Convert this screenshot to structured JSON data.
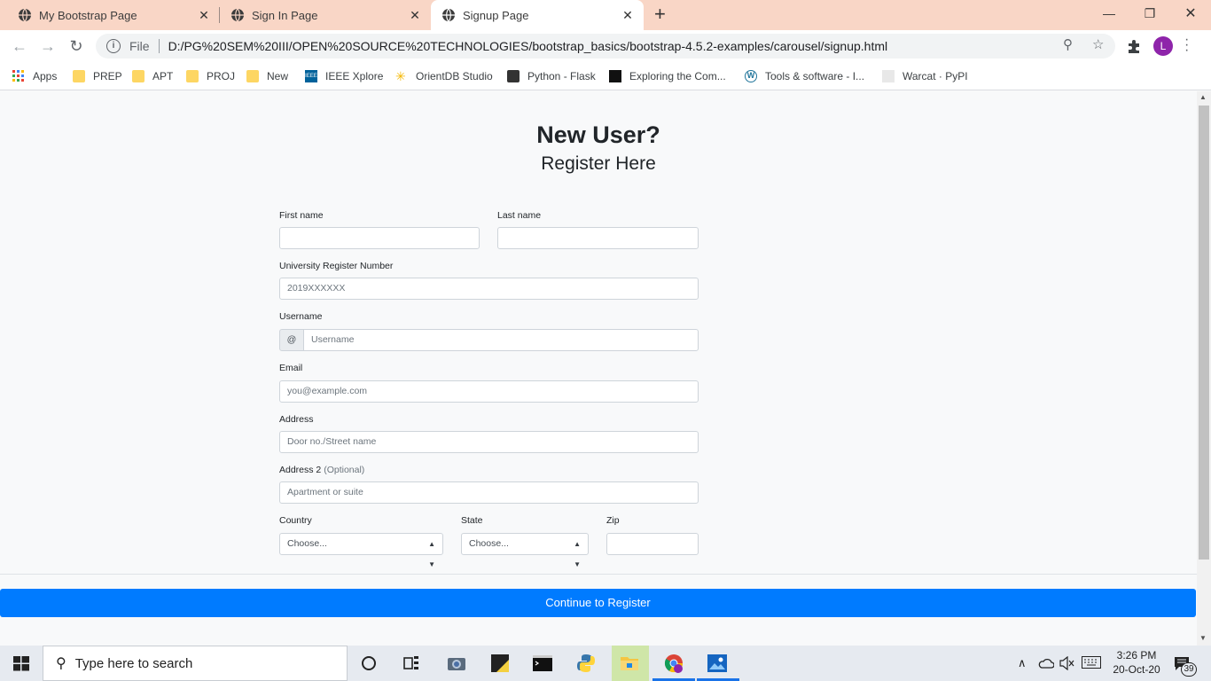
{
  "browser": {
    "tabs": [
      {
        "title": "My Bootstrap Page"
      },
      {
        "title": "Sign In Page"
      },
      {
        "title": "Signup Page"
      }
    ],
    "new_tab_label": "+",
    "url_scheme_label": "File",
    "url": "D:/PG%20SEM%20III/OPEN%20SOURCE%20TECHNOLOGIES/bootstrap_basics/bootstrap-4.5.2-examples/carousel/signup.html",
    "profile_initial": "L",
    "bookmarks": [
      {
        "label": "Apps",
        "icon": "apps-grid-icon"
      },
      {
        "label": "PREP",
        "icon": "folder-icon"
      },
      {
        "label": "APT",
        "icon": "folder-icon"
      },
      {
        "label": "PROJ",
        "icon": "folder-icon"
      },
      {
        "label": "New",
        "icon": "folder-icon"
      },
      {
        "label": "IEEE Xplore",
        "icon": "ieee-icon"
      },
      {
        "label": "OrientDB Studio",
        "icon": "orientdb-icon"
      },
      {
        "label": "Python - Flask",
        "icon": "terminal-icon"
      },
      {
        "label": "Exploring the Com...",
        "icon": "site-icon"
      },
      {
        "label": "Tools & software - I...",
        "icon": "wordpress-icon"
      },
      {
        "label": "Warcat · PyPI",
        "icon": "pypi-icon"
      }
    ]
  },
  "form": {
    "heading": "New User?",
    "subheading": "Register Here",
    "first_name_label": "First name",
    "last_name_label": "Last name",
    "reg_number_label": "University Register Number",
    "reg_number_placeholder": "2019XXXXXX",
    "username_label": "Username",
    "username_prefix": "@",
    "username_placeholder": "Username",
    "email_label": "Email",
    "email_placeholder": "you@example.com",
    "address_label": "Address",
    "address_placeholder": "Door no./Street name",
    "address2_label": "Address 2",
    "address2_optional": "(Optional)",
    "address2_placeholder": "Apartment or suite",
    "country_label": "Country",
    "country_value": "Choose...",
    "state_label": "State",
    "state_value": "Choose...",
    "zip_label": "Zip",
    "submit_label": "Continue to Register"
  },
  "taskbar": {
    "search_placeholder": "Type here to search",
    "time": "3:26 PM",
    "date": "20-Oct-20",
    "notification_count": "39"
  },
  "colors": {
    "tabstrip": "#f9d6c6",
    "primary_button": "#007bff",
    "profile_avatar": "#8e24aa"
  }
}
